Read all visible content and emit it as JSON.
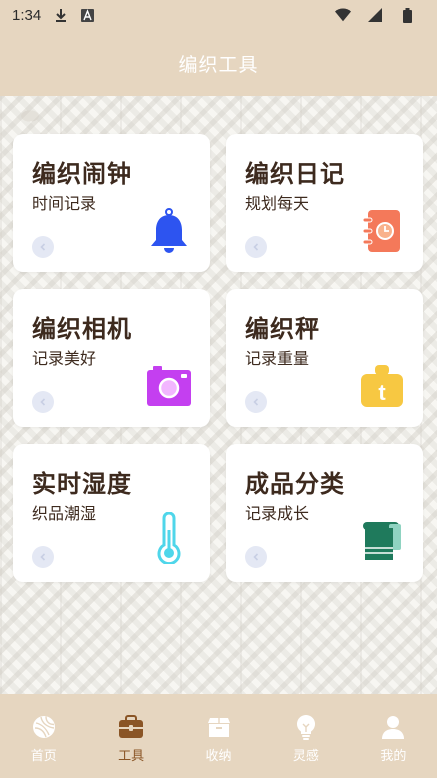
{
  "status": {
    "time": "1:34"
  },
  "header": {
    "title": "编织工具"
  },
  "cards": [
    {
      "title": "编织闹钟",
      "subtitle": "时间记录",
      "icon": "bell-icon",
      "color": "#2d54f0"
    },
    {
      "title": "编织日记",
      "subtitle": "规划每天",
      "icon": "diary-icon",
      "color": "#f4795a"
    },
    {
      "title": "编织相机",
      "subtitle": "记录美好",
      "icon": "camera-icon",
      "color": "#c43ff0"
    },
    {
      "title": "编织秤",
      "subtitle": "记录重量",
      "icon": "scale-icon",
      "color": "#f7c842"
    },
    {
      "title": "实时湿度",
      "subtitle": "织品潮湿",
      "icon": "thermometer-icon",
      "color": "#4fd6ea"
    },
    {
      "title": "成品分类",
      "subtitle": "记录成长",
      "icon": "towel-icon",
      "color": "#1f7a5c"
    }
  ],
  "tabs": [
    {
      "label": "首页",
      "icon": "yarn-ball-icon"
    },
    {
      "label": "工具",
      "icon": "toolbox-icon",
      "active": true
    },
    {
      "label": "收纳",
      "icon": "storage-box-icon"
    },
    {
      "label": "灵感",
      "icon": "lightbulb-icon"
    },
    {
      "label": "我的",
      "icon": "user-icon"
    }
  ],
  "colors": {
    "bar": "#e6d6c0",
    "active_tab": "#8a5526",
    "title_text": "#3d2a1e"
  }
}
